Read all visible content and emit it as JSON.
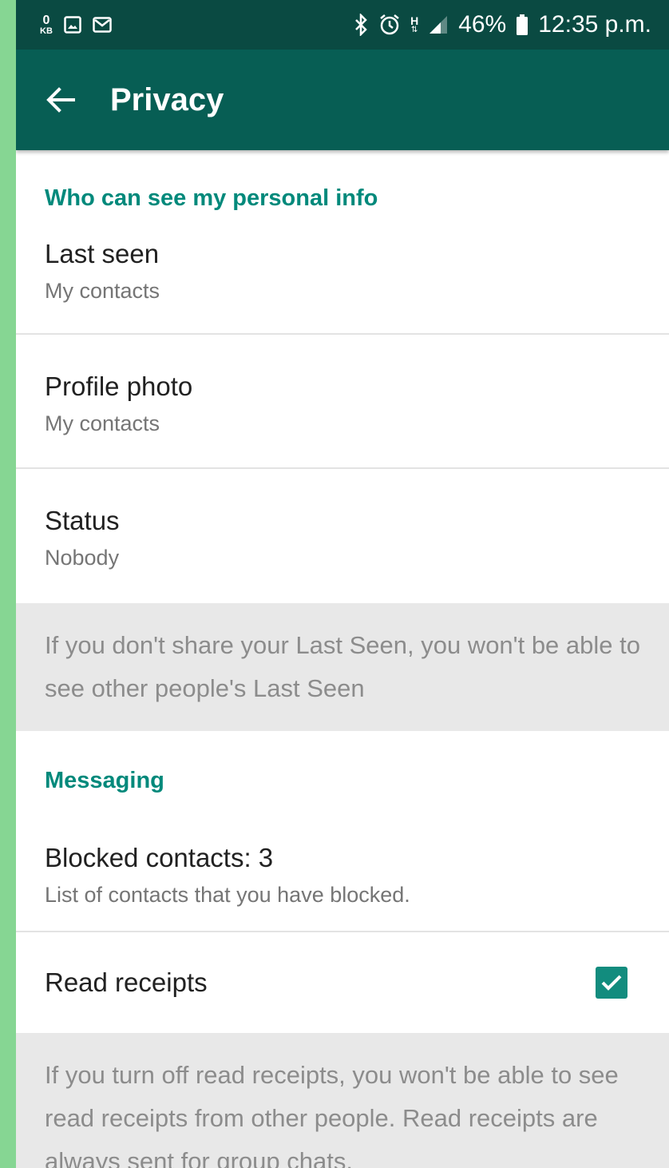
{
  "status_bar": {
    "left_icons": [
      "data-speed-icon",
      "image-icon",
      "mail-icon"
    ],
    "data_speed": "0",
    "data_unit": "KB",
    "network_type": "H",
    "battery_percent": "46%",
    "time": "12:35 p.m."
  },
  "toolbar": {
    "title": "Privacy",
    "back_icon": "arrow-left-icon"
  },
  "section_personal": {
    "header": "Who can see my personal info",
    "items": [
      {
        "label": "Last seen",
        "value": "My contacts"
      },
      {
        "label": "Profile photo",
        "value": "My contacts"
      },
      {
        "label": "Status",
        "value": "Nobody"
      }
    ],
    "info": "If you don't share your Last Seen, you won't be able to see other people's Last Seen"
  },
  "section_messaging": {
    "header": "Messaging",
    "blocked": {
      "label": "Blocked contacts: 3",
      "description": "List of contacts that you have blocked."
    },
    "read_receipts": {
      "label": "Read receipts",
      "checked": true
    },
    "info": "If you turn off read receipts, you won't be able to see read receipts from other people. Read receipts are always sent for group chats."
  },
  "colors": {
    "status_bar": "#0a4a42",
    "toolbar": "#075e54",
    "accent": "#00897b",
    "checkbox": "#128c7e",
    "background_strip": "#86d693"
  }
}
